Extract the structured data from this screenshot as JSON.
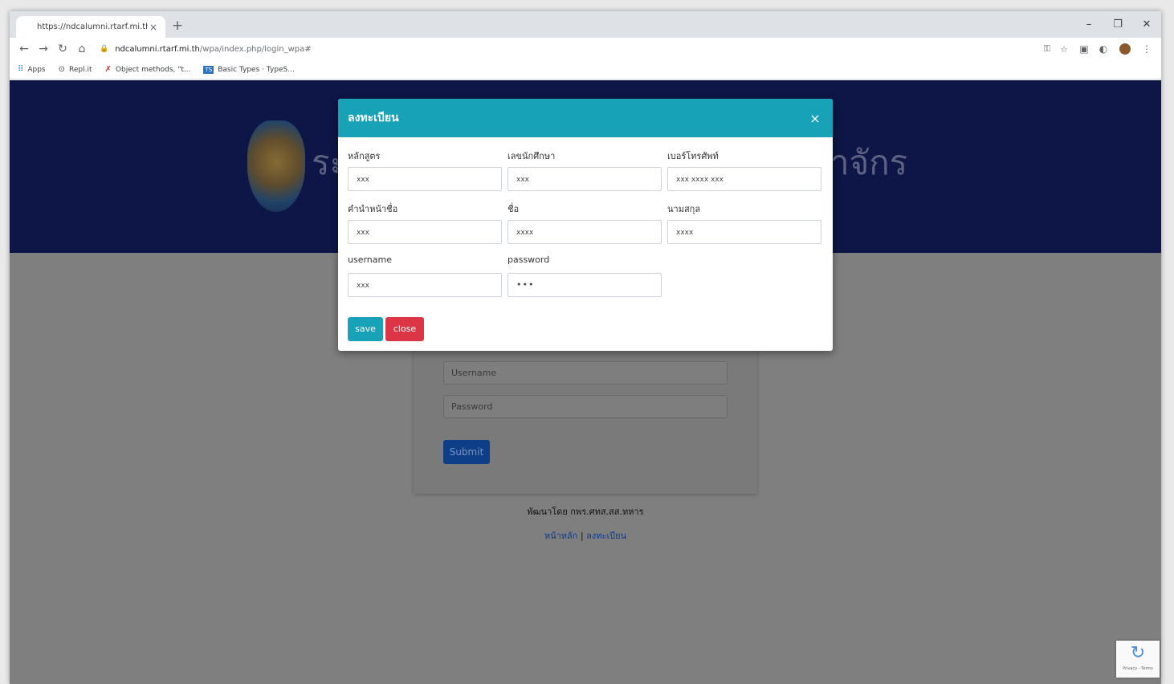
{
  "browser": {
    "tab_title": "https://ndcalumni.rtarf.mi.th/wpa",
    "tab_close": "×",
    "new_tab": "+",
    "window_controls": {
      "minimize": "–",
      "restore": "❐",
      "close": "✕"
    },
    "nav": {
      "back": "←",
      "forward": "→",
      "reload": "↻",
      "home": "⌂"
    },
    "url": {
      "host": "ndcalumni.rtarf.mi.th",
      "path": "/wpa/index.php/login_wpa#"
    },
    "bookmarks": [
      {
        "label": "Apps",
        "icon": "apps-grid-icon"
      },
      {
        "label": "Repl.it",
        "icon": "replit-icon"
      },
      {
        "label": "Object methods, \"t...",
        "icon": "object-methods-icon"
      },
      {
        "label": "Basic Types · TypeS...",
        "icon": "typescript-icon",
        "icon_text": "TS"
      }
    ]
  },
  "page": {
    "banner_title_left": "ระ",
    "banner_title_right": "าจักร",
    "login": {
      "username_placeholder": "Username",
      "password_placeholder": "Password",
      "submit_label": "Submit"
    },
    "credit": "พัฒนาโดย กพร.ศทส.สส.ทหาร",
    "links": {
      "home": "หน้าหลัก",
      "separator": "|",
      "register": "ลงทะเบียน"
    },
    "recaptcha_text": "Privacy - Terms"
  },
  "modal": {
    "title": "ลงทะเบียน",
    "close_glyph": "×",
    "fields": [
      [
        {
          "label": "หลักสูตร",
          "value": "xxx"
        },
        {
          "label": "เลขนักศึกษา",
          "value": "xxx"
        },
        {
          "label": "เบอร์โทรศัพท์",
          "value": "xxx xxxx xxx"
        }
      ],
      [
        {
          "label": "คำนำหน้าชื่อ",
          "value": "xxx"
        },
        {
          "label": "ชื่อ",
          "value": "xxxx"
        },
        {
          "label": "นามสกุล",
          "value": "xxxx"
        }
      ],
      [
        {
          "label": "username",
          "value": "xxx"
        },
        {
          "label": "password",
          "value": "•••"
        }
      ]
    ],
    "save_label": "save",
    "close_label": "close"
  }
}
